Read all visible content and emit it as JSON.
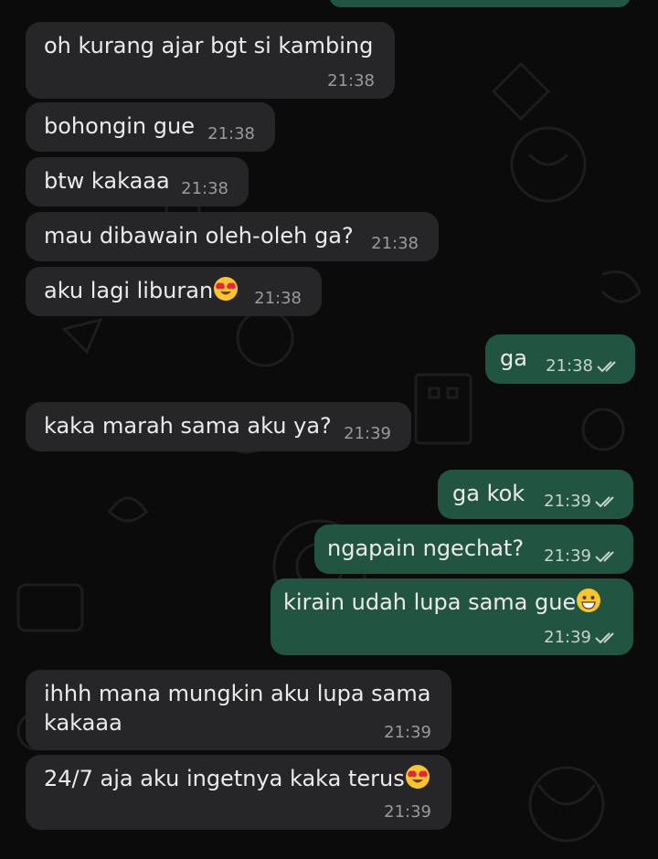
{
  "chat": {
    "messages": [
      {
        "dir": "in",
        "text": "oh kurang ajar bgt si kambing",
        "time": "21:38"
      },
      {
        "dir": "in",
        "text": "bohongin gue",
        "time": "21:38"
      },
      {
        "dir": "in",
        "text": "btw kakaaa",
        "time": "21:38"
      },
      {
        "dir": "in",
        "text": "mau dibawain oleh-oleh ga?",
        "time": "21:38"
      },
      {
        "dir": "in",
        "text": "aku lagi liburan",
        "emoji": "heart-eyes-emoji",
        "time": "21:38"
      },
      {
        "dir": "out",
        "text": "ga",
        "time": "21:38",
        "status": "read-ticks-icon"
      },
      {
        "dir": "in",
        "text": "kaka marah sama aku ya?",
        "time": "21:39"
      },
      {
        "dir": "out",
        "text": "ga kok",
        "time": "21:39",
        "status": "read-ticks-icon"
      },
      {
        "dir": "out",
        "text": "ngapain ngechat?",
        "time": "21:39",
        "status": "read-ticks-icon"
      },
      {
        "dir": "out",
        "text": "kirain udah lupa sama gue",
        "emoji": "grinning-emoji",
        "time": "21:39",
        "status": "read-ticks-icon"
      },
      {
        "dir": "in",
        "text_line1": "ihhh mana mungkin aku lupa sama",
        "text_line2": "kakaaa",
        "time": "21:39"
      },
      {
        "dir": "in",
        "text": "24/7 aja aku ingetnya kaka terus",
        "emoji": "heart-eyes-emoji",
        "time": "21:39"
      }
    ]
  },
  "colors": {
    "background": "#0b0b0b",
    "incoming_bubble": "#262628",
    "outgoing_bubble": "#225541",
    "text": "#ebebeb",
    "timestamp": "#9a9a9a"
  }
}
